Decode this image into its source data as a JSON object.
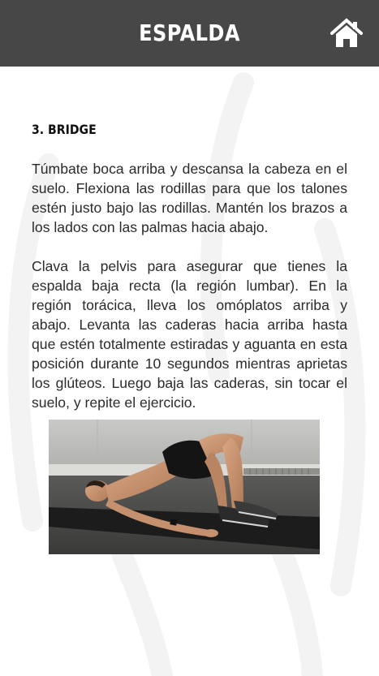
{
  "header": {
    "title": "ESPALDA",
    "home_icon": "home-icon",
    "background_color": "#474747"
  },
  "exercise": {
    "title": "3. BRIDGE",
    "paragraphs": [
      "Túmbate boca arriba y descansa la cabeza en el suelo. Flexiona las rodillas para que los talones estén justo bajo las rodillas. Mantén los brazos a los lados con las palmas hacia abajo.",
      "Clava la pelvis para asegurar que tienes la espalda baja recta (la región lumbar). En la región torácica, lleva los omóplatos arriba y abajo. Levanta las caderas hacia arriba hasta que estén totalmente estiradas y aguanta en esta posición durante 10 segundos mientras aprietas los glúteos. Luego baja las caderas, sin tocar el suelo, y repite el ejercicio."
    ]
  }
}
